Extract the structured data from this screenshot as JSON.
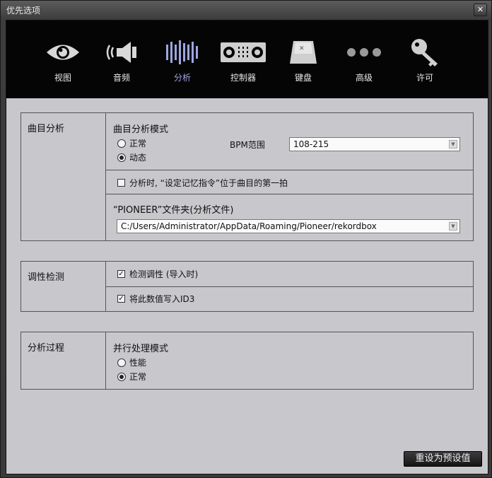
{
  "window": {
    "title": "优先选项",
    "close_label": "✕"
  },
  "tabs": [
    {
      "label": "视图",
      "icon": "eye-icon"
    },
    {
      "label": "音频",
      "icon": "speaker-icon"
    },
    {
      "label": "分析",
      "icon": "waveform-icon",
      "active": true
    },
    {
      "label": "控制器",
      "icon": "controller-icon"
    },
    {
      "label": "键盘",
      "icon": "keyboard-icon"
    },
    {
      "label": "高级",
      "icon": "dots-icon"
    },
    {
      "label": "许可",
      "icon": "key-icon"
    }
  ],
  "track_analysis": {
    "header": "曲目分析",
    "mode_label": "曲目分析模式",
    "mode_options": [
      "正常",
      "动态"
    ],
    "mode_selected": "动态",
    "bpm_label": "BPM范围",
    "bpm_value": "108-215",
    "cue_checkbox_label": "分析时, “设定记忆指令”位于曲目的第一拍",
    "cue_checked": false,
    "folder_label": "“PIONEER”文件夹(分析文件)",
    "folder_value": "C:/Users/Administrator/AppData/Roaming/Pioneer/rekordbox"
  },
  "key_detection": {
    "header": "调性检测",
    "detect_label": "检测调性 (导入时)",
    "detect_checked": true,
    "write_label": "将此数值写入ID3",
    "write_checked": true
  },
  "analysis_process": {
    "header": "分析过程",
    "mode_label": "并行处理模式",
    "options": [
      "性能",
      "正常"
    ],
    "selected": "正常"
  },
  "footer": {
    "reset_label": "重设为预设值"
  },
  "colors": {
    "accent": "#9fa5e0",
    "panel": "#c8c7cc",
    "toolbar": "#050505"
  }
}
